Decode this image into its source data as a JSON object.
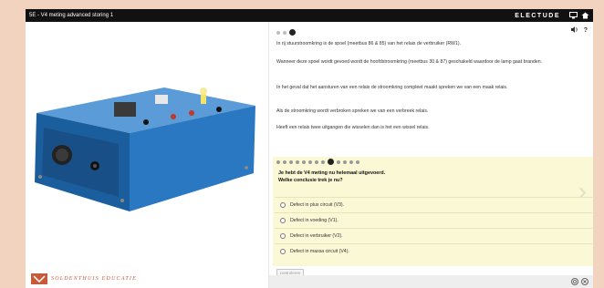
{
  "window": {
    "title": "5E - V4 meting advanced storing 1",
    "brand": "ELECTUDE"
  },
  "logo": {
    "text": "SOLDENTHUIS EDUCATIE"
  },
  "content": {
    "paragraphs": [
      "In rij stuurstroomkring is de spoel (meetbus 86 & 85) van het relais de verbruiker (RW1).",
      "Wanneer deze spoel wordt gevoed wordt de hoofdstroomkring (meetbus 30 & 87) geschakeld waardoor de lamp gaat branden.",
      "In het geval dat het aansturen van een relais de stroomkring compleet maakt spreken we van een maak relais.",
      "Als de stroomkring wordt verbroken spreken we van een verbreek relais.",
      "Heeft een relais twee uitgangen die wisselen dan is het een wissel relais."
    ]
  },
  "question": {
    "text_line1": "Je hebt de V4 meting nu helemaal uitgevoerd.",
    "text_line2": "Welke conclusie trek je nu?",
    "options": [
      "Defect in plus circuit (V3).",
      "Defect in voeding (V1).",
      "Defect in verbruiker (V2).",
      "Defect in massa circuit (V4)."
    ],
    "submit_label": "controleren"
  },
  "icons": {
    "titlebar": [
      "monitor-icon",
      "home-icon"
    ],
    "top": [
      "speaker-icon",
      "help-icon"
    ],
    "bottom": [
      "settings-icon",
      "close-icon"
    ]
  },
  "colors": {
    "titlebar_bg": "#111111",
    "question_bg": "#fbf8d6",
    "device_blue": "#1f6fb8"
  }
}
